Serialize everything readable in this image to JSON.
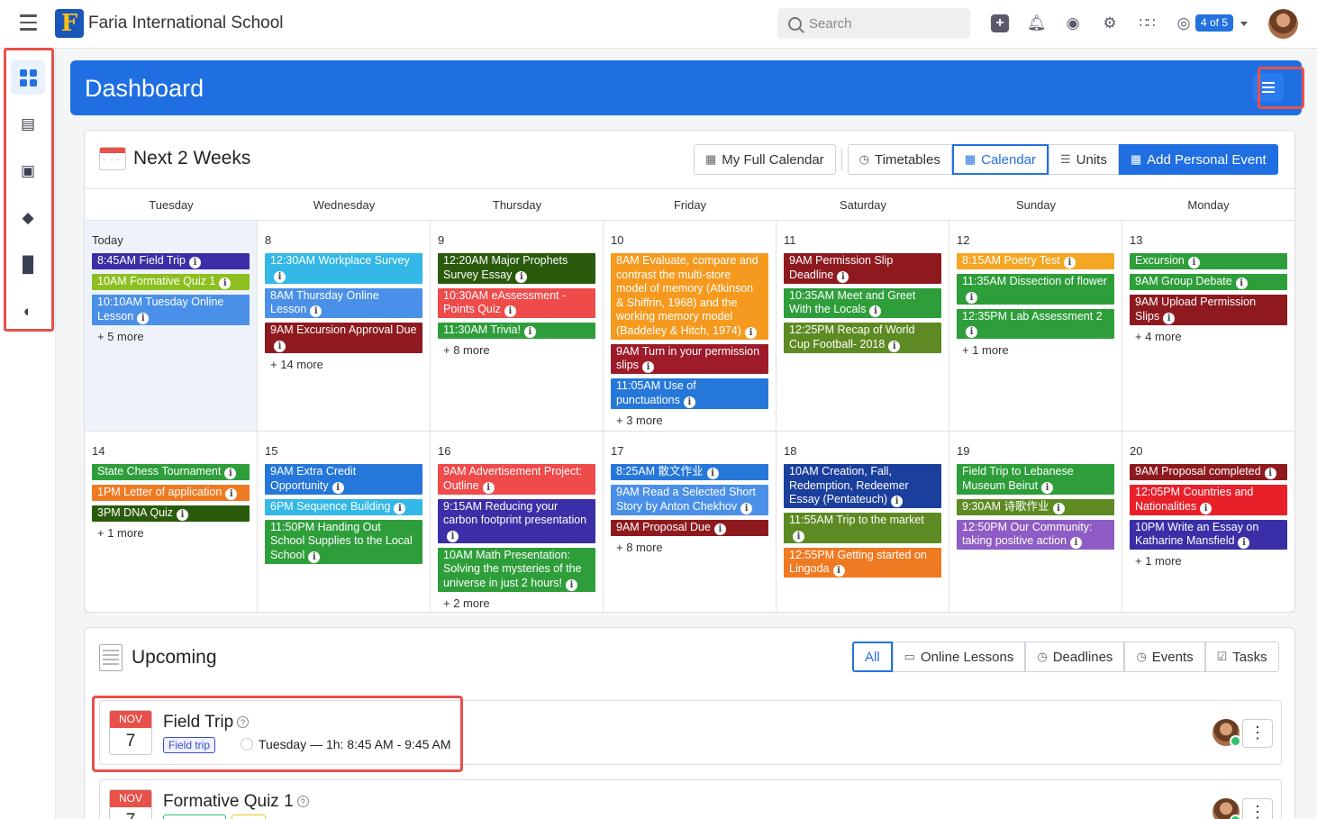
{
  "header": {
    "school_name": "Faria International School",
    "search_placeholder": "Search",
    "counter_badge": "4 of 5"
  },
  "dashboard": {
    "title": "Dashboard"
  },
  "calendar": {
    "title": "Next 2 Weeks",
    "buttons": {
      "full_calendar": "My Full Calendar",
      "timetables": "Timetables",
      "calendar": "Calendar",
      "units": "Units",
      "add_event": "Add Personal Event"
    },
    "days": [
      "Tuesday",
      "Wednesday",
      "Thursday",
      "Friday",
      "Saturday",
      "Sunday",
      "Monday"
    ],
    "weeks": [
      [
        {
          "day": "Today",
          "today": true,
          "events": [
            {
              "text": "8:45AM Field Trip",
              "color": "#3a2fa6"
            },
            {
              "text": "10AM Formative Quiz 1",
              "color": "#8cbf1f"
            },
            {
              "text": "10:10AM Tuesday Online Lesson",
              "color": "#4a90e8"
            }
          ],
          "more": "+ 5 more"
        },
        {
          "day": "8",
          "events": [
            {
              "text": "12:30AM Workplace Survey",
              "color": "#33b8e8"
            },
            {
              "text": "8AM Thursday Online Lesson",
              "color": "#4a90e8"
            },
            {
              "text": "9AM Excursion Approval Due",
              "color": "#8e1a1f"
            }
          ],
          "more": "+ 14 more"
        },
        {
          "day": "9",
          "events": [
            {
              "text": "12:20AM Major Prophets Survey Essay",
              "color": "#2a5b0c"
            },
            {
              "text": "10:30AM eAssessment - Points Quiz",
              "color": "#ef4b4b"
            },
            {
              "text": "11:30AM Trivia!",
              "color": "#2e9e3a"
            }
          ],
          "more": "+ 8 more"
        },
        {
          "day": "10",
          "events": [
            {
              "text": "8AM Evaluate, compare and contrast the multi-store model of memory (Atkinson & Shiffrin, 1968) and the working memory model (Baddeley & Hitch, 1974)",
              "color": "#f59a1e"
            },
            {
              "text": "9AM Turn in your permission slips",
              "color": "#9e1b2a"
            },
            {
              "text": "11:05AM Use of punctuations",
              "color": "#2577d9"
            }
          ],
          "more": "+ 3 more"
        },
        {
          "day": "11",
          "events": [
            {
              "text": "9AM Permission Slip Deadline",
              "color": "#8e1a1f"
            },
            {
              "text": "10:35AM Meet and Greet With the Locals",
              "color": "#2e9e3a"
            },
            {
              "text": "12:25PM Recap of World Cup Football- 2018",
              "color": "#5d8a22"
            }
          ],
          "more": ""
        },
        {
          "day": "12",
          "events": [
            {
              "text": "8:15AM Poetry Test",
              "color": "#f5a623"
            },
            {
              "text": "11:35AM Dissection of flower",
              "color": "#2e9e3a"
            },
            {
              "text": "12:35PM Lab Assessment 2",
              "color": "#2e9e3a"
            }
          ],
          "more": "+ 1 more"
        },
        {
          "day": "13",
          "events": [
            {
              "text": "Excursion",
              "color": "#2e9e3a"
            },
            {
              "text": "9AM Group Debate",
              "color": "#2e9e3a"
            },
            {
              "text": "9AM Upload Permission Slips",
              "color": "#8e1a1f"
            }
          ],
          "more": "+ 4 more"
        }
      ],
      [
        {
          "day": "14",
          "events": [
            {
              "text": "State Chess Tournament",
              "color": "#2e9e3a"
            },
            {
              "text": "1PM Letter of application",
              "color": "#f07a22"
            },
            {
              "text": "3PM DNA Quiz",
              "color": "#2a5b0c"
            }
          ],
          "more": "+ 1 more"
        },
        {
          "day": "15",
          "events": [
            {
              "text": "9AM Extra Credit Opportunity",
              "color": "#2577d9"
            },
            {
              "text": "6PM Sequence Building",
              "color": "#33b8e8"
            },
            {
              "text": "11:50PM Handing Out School Supplies to the Local School",
              "color": "#2e9e3a"
            }
          ],
          "more": ""
        },
        {
          "day": "16",
          "events": [
            {
              "text": "9AM Advertisement Project: Outline",
              "color": "#ef4b4b"
            },
            {
              "text": "9:15AM Reducing your carbon footprint presentation",
              "color": "#3a2fa6"
            },
            {
              "text": "10AM Math Presentation: Solving the mysteries of the universe in just 2 hours!",
              "color": "#2e9e3a"
            }
          ],
          "more": "+ 2 more"
        },
        {
          "day": "17",
          "events": [
            {
              "text": "8:25AM 散文作业",
              "color": "#2577d9"
            },
            {
              "text": "9AM Read a Selected Short Story by Anton Chekhov",
              "color": "#4a90e8"
            },
            {
              "text": "9AM Proposal Due",
              "color": "#8e1a1f"
            }
          ],
          "more": "+ 8 more"
        },
        {
          "day": "18",
          "events": [
            {
              "text": "10AM Creation, Fall, Redemption, Redeemer Essay (Pentateuch)",
              "color": "#1b3f9c"
            },
            {
              "text": "11:55AM Trip to the market",
              "color": "#5d8a22"
            },
            {
              "text": "12:55PM Getting started on Lingoda",
              "color": "#f07a22"
            }
          ],
          "more": ""
        },
        {
          "day": "19",
          "events": [
            {
              "text": "Field Trip to Lebanese Museum Beirut",
              "color": "#2e9e3a"
            },
            {
              "text": "9:30AM 诗歌作业",
              "color": "#5d8a22"
            },
            {
              "text": "12:50PM Our Community: taking positive action",
              "color": "#8e5cc4"
            }
          ],
          "more": ""
        },
        {
          "day": "20",
          "events": [
            {
              "text": "9AM Proposal completed",
              "color": "#8e1a1f"
            },
            {
              "text": "12:05PM Countries and Nationalities",
              "color": "#e8202a"
            },
            {
              "text": "10PM Write an Essay on Katharine Mansfield",
              "color": "#3a2fa6"
            }
          ],
          "more": "+ 1 more"
        }
      ]
    ]
  },
  "upcoming": {
    "title": "Upcoming",
    "filters": {
      "all": "All",
      "online": "Online Lessons",
      "deadlines": "Deadlines",
      "events": "Events",
      "tasks": "Tasks"
    },
    "items": [
      {
        "month": "NOV",
        "day": "7",
        "title": "Field Trip",
        "tag": "Field trip",
        "time": "Tuesday — 1h: 8:45 AM - 9:45 AM"
      },
      {
        "month": "NOV",
        "day": "7",
        "title": "Formative Quiz 1"
      }
    ]
  }
}
